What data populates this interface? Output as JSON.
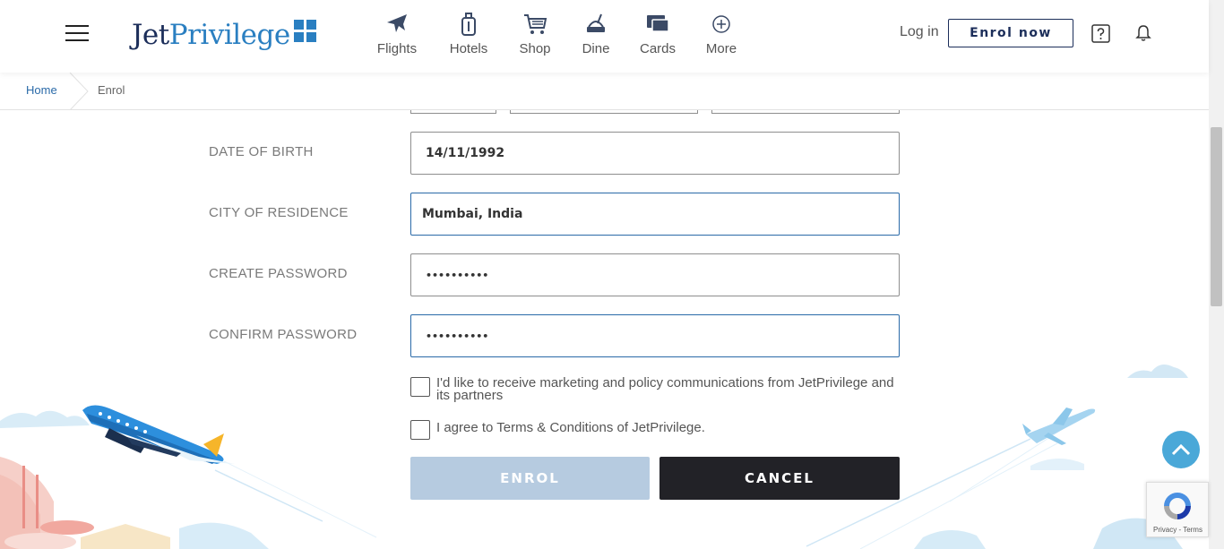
{
  "header": {
    "logo_text_1": "Jet",
    "logo_text_2": "Privilege",
    "nav": [
      {
        "label": "Flights",
        "icon": "airplane-icon"
      },
      {
        "label": "Hotels",
        "icon": "luggage-icon"
      },
      {
        "label": "Shop",
        "icon": "shopping-cart-icon"
      },
      {
        "label": "Dine",
        "icon": "dining-icon"
      },
      {
        "label": "Cards",
        "icon": "card-icon"
      },
      {
        "label": "More",
        "icon": "plus-circle-icon"
      }
    ],
    "login_label": "Log in",
    "enrol_label": "Enrol now"
  },
  "breadcrumb": {
    "home": "Home",
    "current": "Enrol"
  },
  "form": {
    "dob": {
      "label": "DATE OF BIRTH",
      "value": "14/11/1992"
    },
    "city": {
      "label": "CITY OF RESIDENCE",
      "value": "Mumbai, India"
    },
    "password": {
      "label": "CREATE PASSWORD",
      "value": "••••••••••"
    },
    "confirm": {
      "label": "CONFIRM PASSWORD",
      "value": "••••••••••"
    },
    "marketing_text": "I'd like to receive marketing and policy communications from JetPrivilege and its partners",
    "terms_prefix": "I agree to ",
    "terms_link": "Terms & Conditions",
    "terms_suffix": " of JetPrivilege.",
    "enrol_button": "ENROL",
    "cancel_button": "CANCEL"
  },
  "recaptcha": {
    "links": "Privacy - Terms"
  },
  "colors": {
    "brand_navy": "#1c2e5a",
    "brand_blue": "#2a7fc1",
    "enrol_disabled": "#b6cbe0",
    "cancel_dark": "#222227",
    "back_top": "#4aa8d8"
  }
}
